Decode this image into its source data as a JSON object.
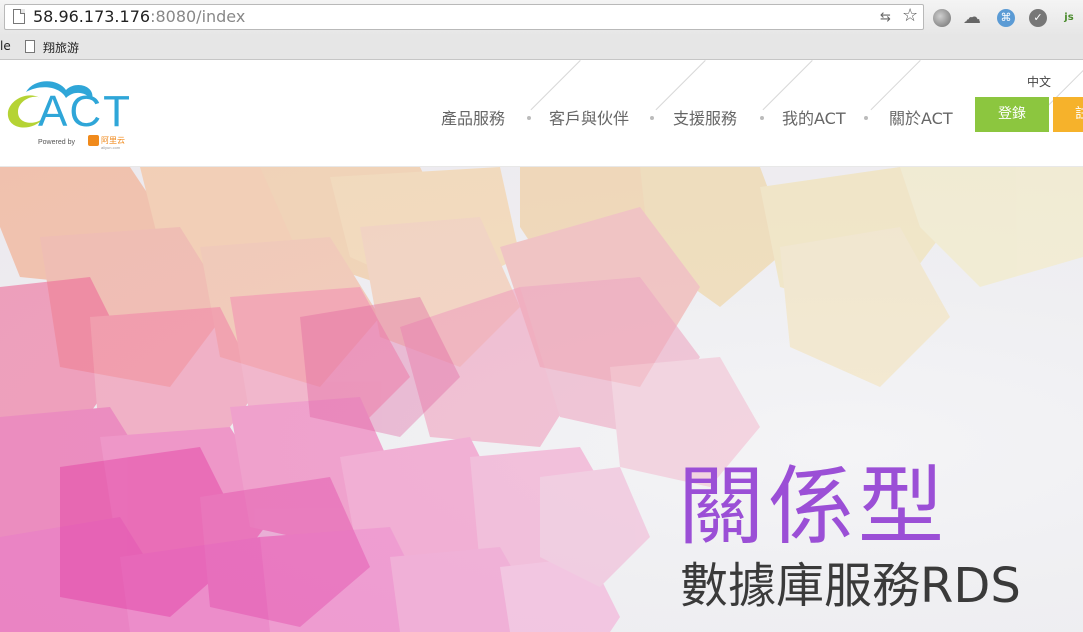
{
  "browser": {
    "url_host": "58.96.173.176",
    "url_rest": ":8080/index",
    "bookmarks": {
      "partial": "le",
      "item": "翔旅游"
    }
  },
  "header": {
    "logo": {
      "brand": "ACT",
      "powered": "Powered by",
      "partner": "阿里云",
      "partner_sub": "aliyun.com"
    },
    "language": "中文",
    "nav": [
      "產品服務",
      "客戶與伙伴",
      "支援服務",
      "我的ACT",
      "關於ACT"
    ],
    "login": "登錄",
    "register": "註",
    "colors": {
      "login": "#8cc63f",
      "register": "#f6b22b"
    }
  },
  "hero": {
    "title": "關係型",
    "subtitle": "數據庫服務RDS",
    "title_color": "#9b4fd6"
  }
}
